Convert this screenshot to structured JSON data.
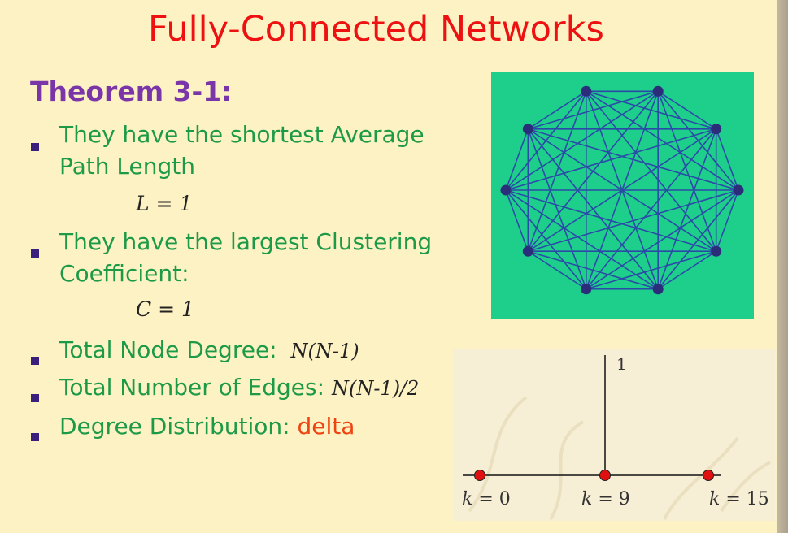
{
  "title": "Fully-Connected Networks",
  "theorem": "Theorem 3-1:",
  "bullets": {
    "b1_line1": "They have the shortest Average",
    "b1_line2": "Path Length",
    "formula_L": "L = 1",
    "b2_line1": "They have the largest Clustering",
    "b2_line2": "Coefficient:",
    "formula_C": "C = 1",
    "b3_text": "Total Node Degree:",
    "b3_math": "N(N-1)",
    "b4_text": "Total Number of Edges:",
    "b4_math": "N(N-1)/2",
    "b5_text": "Degree Distribution:",
    "b5_highlight": "delta"
  },
  "distribution": {
    "peak_label": "1",
    "k_var": "k",
    "k_labels": [
      "= 0",
      "= 9",
      "= 15"
    ]
  },
  "network": {
    "node_count": 10,
    "background_color": "#1ecf8c",
    "edge_color": "#2b4aa8",
    "node_color": "#2b2c7a"
  },
  "colors": {
    "title": "#ee1111",
    "theorem": "#7a35a8",
    "bullet_text": "#1d9a48",
    "highlight": "#ee4411",
    "dot": "#e01010"
  }
}
